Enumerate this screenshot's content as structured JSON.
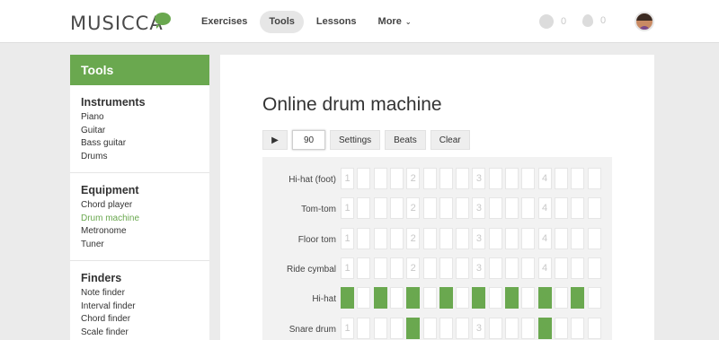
{
  "header": {
    "logo": "MUSICCA",
    "nav": [
      {
        "label": "Exercises",
        "active": false
      },
      {
        "label": "Tools",
        "active": true
      },
      {
        "label": "Lessons",
        "active": false
      },
      {
        "label": "More",
        "active": false,
        "caret": "⌄"
      }
    ],
    "coins": "0",
    "drops": "0"
  },
  "sidebar": {
    "title": "Tools",
    "sections": [
      {
        "title": "Instruments",
        "items": [
          "Piano",
          "Guitar",
          "Bass guitar",
          "Drums"
        ]
      },
      {
        "title": "Equipment",
        "items": [
          "Chord player",
          "Drum machine",
          "Metronome",
          "Tuner"
        ],
        "active_item": "Drum machine"
      },
      {
        "title": "Finders",
        "items": [
          "Note finder",
          "Interval finder",
          "Chord finder",
          "Scale finder"
        ]
      }
    ]
  },
  "main": {
    "title": "Online drum machine",
    "toolbar": {
      "play_icon": "▶",
      "tempo": "90",
      "settings": "Settings",
      "beats": "Beats",
      "clear": "Clear"
    },
    "beat_numbers": [
      "1",
      "",
      "",
      "",
      "2",
      "",
      "",
      "",
      "3",
      "",
      "",
      "",
      "4",
      "",
      "",
      ""
    ],
    "tracks": [
      {
        "name": "Hi-hat (foot)",
        "steps": [
          0,
          0,
          0,
          0,
          0,
          0,
          0,
          0,
          0,
          0,
          0,
          0,
          0,
          0,
          0,
          0
        ]
      },
      {
        "name": "Tom-tom",
        "steps": [
          0,
          0,
          0,
          0,
          0,
          0,
          0,
          0,
          0,
          0,
          0,
          0,
          0,
          0,
          0,
          0
        ]
      },
      {
        "name": "Floor tom",
        "steps": [
          0,
          0,
          0,
          0,
          0,
          0,
          0,
          0,
          0,
          0,
          0,
          0,
          0,
          0,
          0,
          0
        ]
      },
      {
        "name": "Ride cymbal",
        "steps": [
          0,
          0,
          0,
          0,
          0,
          0,
          0,
          0,
          0,
          0,
          0,
          0,
          0,
          0,
          0,
          0
        ]
      },
      {
        "name": "Hi-hat",
        "steps": [
          1,
          0,
          1,
          0,
          1,
          0,
          1,
          0,
          1,
          0,
          1,
          0,
          1,
          0,
          1,
          0
        ]
      },
      {
        "name": "Snare drum",
        "steps": [
          0,
          0,
          0,
          0,
          1,
          0,
          0,
          0,
          0,
          0,
          0,
          0,
          1,
          0,
          0,
          0
        ]
      }
    ]
  },
  "colors": {
    "accent": "#6aa84f"
  }
}
